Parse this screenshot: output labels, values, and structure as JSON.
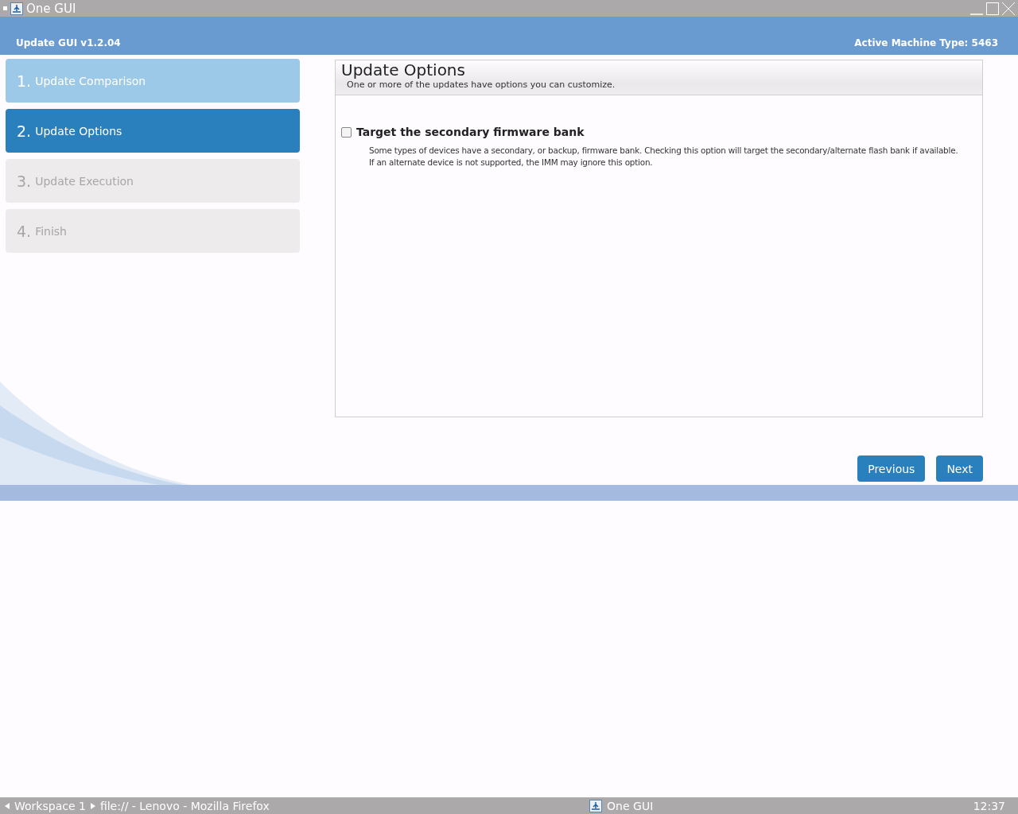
{
  "window": {
    "title": "One GUI"
  },
  "header": {
    "app_version": "Update GUI v1.2.04",
    "machine_type": "Active Machine Type: 5463"
  },
  "steps": [
    {
      "number": "1.",
      "label": "Update Comparison",
      "selected": false,
      "completed": true
    },
    {
      "number": "2.",
      "label": "Update Options",
      "selected": true,
      "completed": false
    },
    {
      "number": "3.",
      "label": "Update Execution",
      "selected": false,
      "completed": false
    },
    {
      "number": "4.",
      "label": "Finish",
      "selected": false,
      "completed": false
    }
  ],
  "panel": {
    "title": "Update Options",
    "subtitle": "One or more of the updates have options you can customize.",
    "options": [
      {
        "label": "Target the secondary firmware bank",
        "checked": false,
        "description": "Some types of devices have a secondary, or backup, firmware bank. Checking this option will target the secondary/alternate flash bank if available. If an alternate device is not supported, the IMM may ignore this option."
      }
    ]
  },
  "buttons": [
    "Previous",
    "Next"
  ],
  "taskbar": {
    "workspace": "Workspace 1",
    "window_left": "file:// - Lenovo - Mozilla Firefox",
    "window_center": "One GUI",
    "clock": "12:37"
  }
}
